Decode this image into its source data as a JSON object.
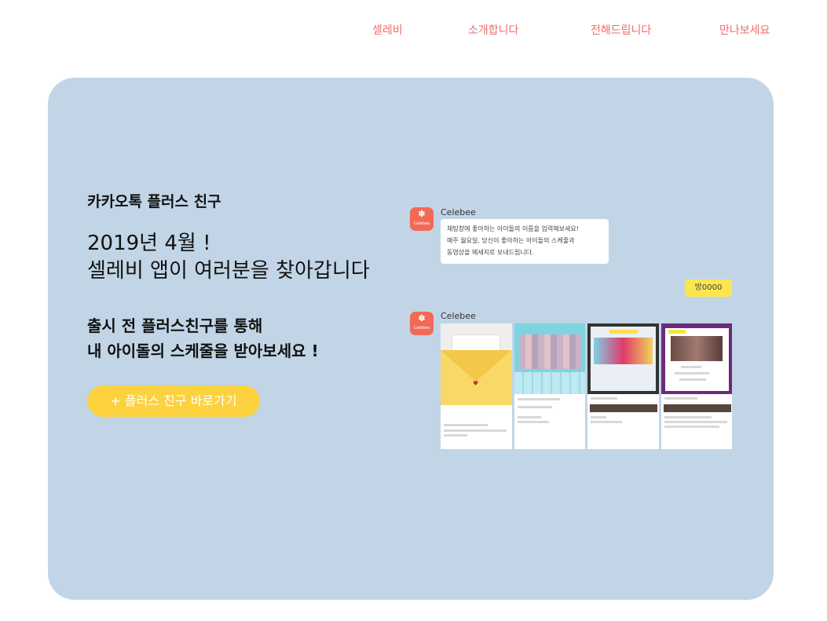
{
  "nav": {
    "items": [
      "셀레비",
      "소개합니다",
      "전해드립니다",
      "만나보세요"
    ]
  },
  "hero": {
    "subtitle": "카카오톡 플러스 친구",
    "headline_line1": "2019년 4월 !",
    "headline_line2": "셀레비 앱이 여러분을 찾아갑니다",
    "desc_line1": "출시 전 플러스친구를 통해",
    "desc_line2": "내 아이돌의 스케줄을 받아보세요 !",
    "cta_label": "+ 플러스 친구 바로가기"
  },
  "chat": {
    "sender": "Celebee",
    "avatar_label": "Celebee",
    "bubble_lines": [
      "채팅창에 좋아하는 아이돌의 이름을 입력해보세요!",
      "매주 월요일, 당신이 좋아하는 아이돌의 스케줄과",
      "동영상을 메세지로 보내드립니다."
    ],
    "reply": "방0000"
  },
  "colors": {
    "nav_text": "#f26a6a",
    "hero_bg": "#c1d5e6",
    "cta_bg": "#fdd23f",
    "avatar_bg": "#f26a55",
    "reply_bg": "#fde54e"
  }
}
